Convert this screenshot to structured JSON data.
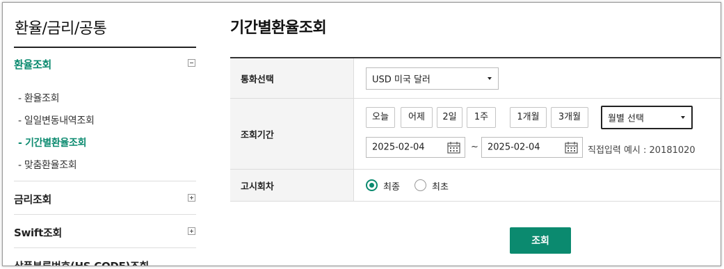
{
  "sidebar": {
    "title": "환율/금리/공통",
    "sections": [
      {
        "label": "환율조회",
        "expanded": true,
        "toggle": "minus",
        "items": [
          "- 환율조회",
          "- 일일변동내역조회",
          "- 기간별환율조회",
          "- 맞춤환율조회"
        ],
        "active_item": "- 기간별환율조회"
      },
      {
        "label": "금리조회",
        "expanded": false,
        "toggle": "plus"
      },
      {
        "label": "Swift조회",
        "expanded": false,
        "toggle": "plus"
      },
      {
        "label": "상품분류번호(HS CODE)조회",
        "expanded": false
      }
    ]
  },
  "main": {
    "title": "기간별환율조회",
    "rows": {
      "currency": {
        "label": "통화선택",
        "selected": "USD 미국 달러"
      },
      "period": {
        "label": "조회기간",
        "quick_buttons": [
          "오늘",
          "어제",
          "2일",
          "1주",
          "1개월",
          "3개월"
        ],
        "month_select": "월별 선택",
        "start_date": "2025-02-04",
        "separator": "~",
        "end_date": "2025-02-04",
        "hint": "직접입력 예시 : 20181020"
      },
      "notice": {
        "label": "고시회차",
        "options": [
          "최종",
          "최초"
        ],
        "selected": "최종"
      }
    },
    "search_button": "조회"
  },
  "colors": {
    "accent": "#0b8a6f",
    "header_bg": "#f4f4f4"
  }
}
